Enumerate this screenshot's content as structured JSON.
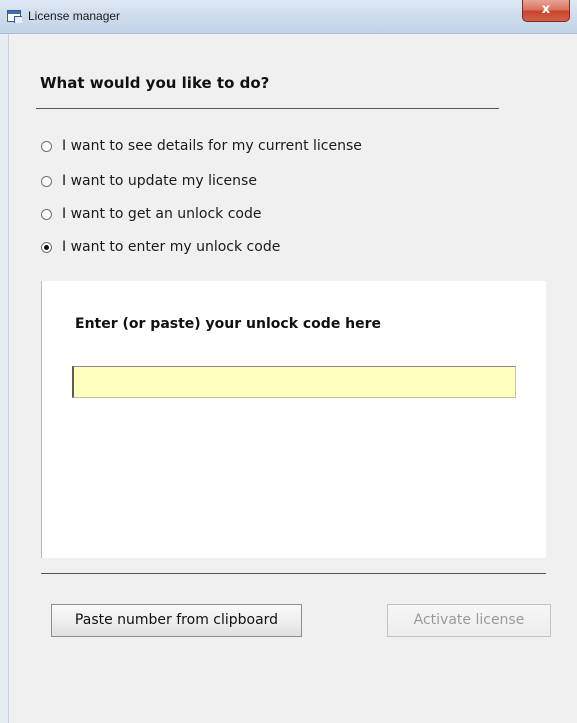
{
  "window": {
    "title": "License manager",
    "close_label": "x",
    "icon": "app-window-icon"
  },
  "main": {
    "heading": "What would you like to do?",
    "options": [
      {
        "label": "I want to see details for my current license",
        "selected": false
      },
      {
        "label": "I want to update my license",
        "selected": false
      },
      {
        "label": "I want to get an unlock code",
        "selected": false
      },
      {
        "label": "I want to enter my unlock code",
        "selected": true
      }
    ]
  },
  "panel": {
    "label": "Enter (or paste) your unlock code here",
    "input_value": "",
    "input_background": "#ffffc0"
  },
  "buttons": {
    "paste_label": "Paste number from clipboard",
    "activate_label": "Activate license",
    "activate_enabled": false
  }
}
